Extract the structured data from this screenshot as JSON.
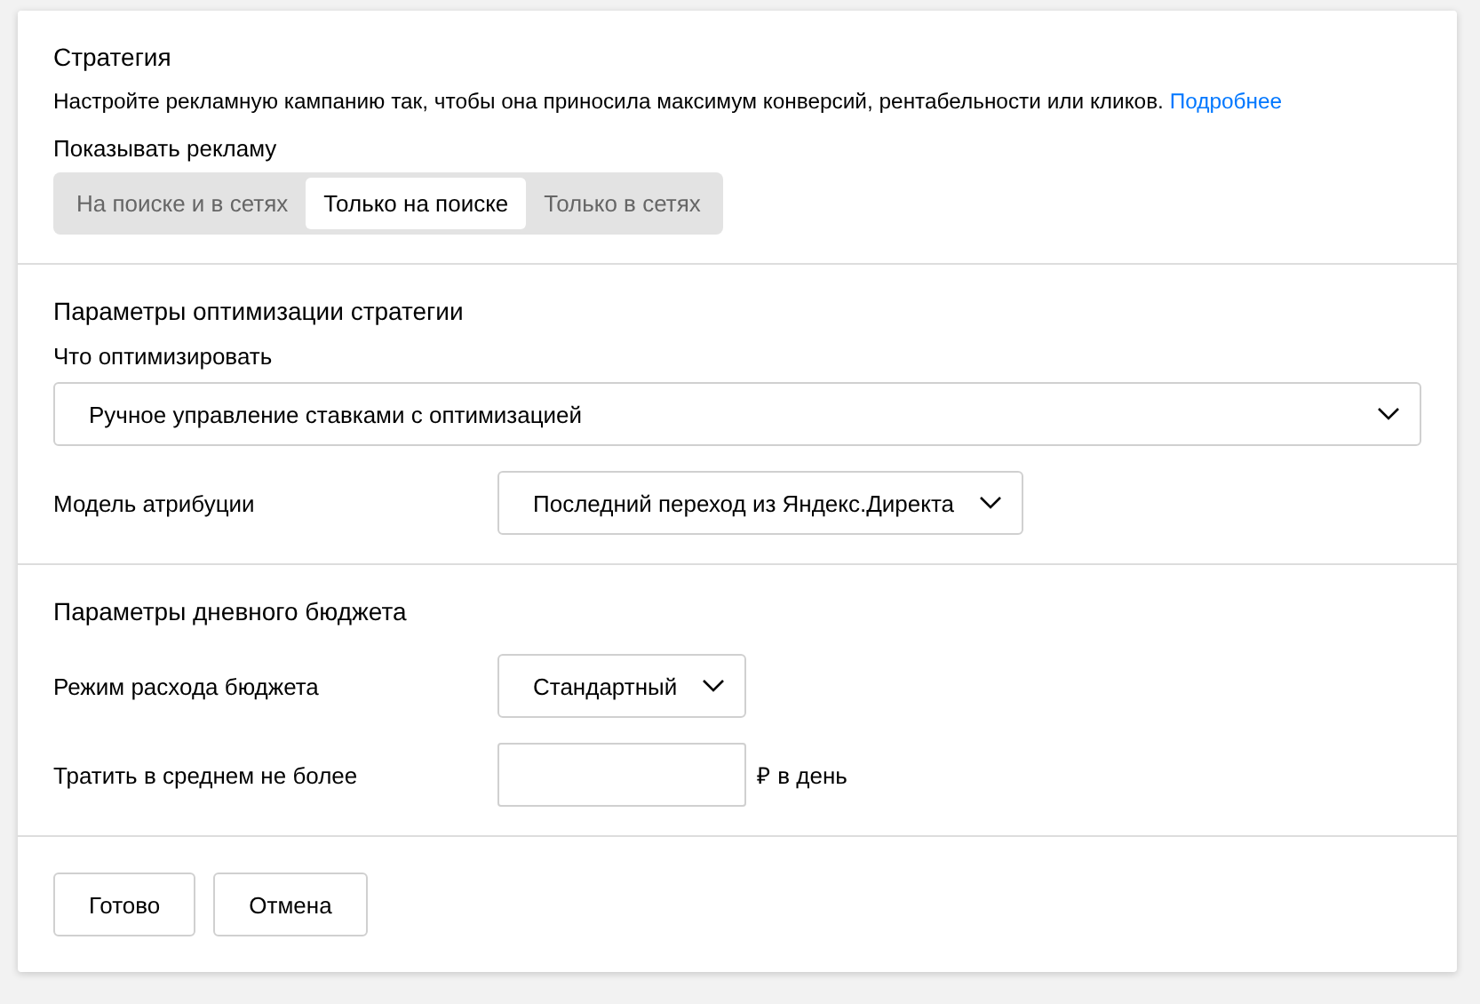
{
  "strategy": {
    "title": "Стратегия",
    "description": "Настройте рекламную кампанию так, чтобы она приносила максимум конверсий, рентабельности или кликов.",
    "link": "Подробнее",
    "show_label": "Показывать рекламу",
    "segments": [
      {
        "label": "На поиске и в сетях",
        "selected": false
      },
      {
        "label": "Только на поиске",
        "selected": true
      },
      {
        "label": "Только в сетях",
        "selected": false
      }
    ]
  },
  "optimization": {
    "title": "Параметры оптимизации стратегии",
    "goal_label": "Что оптимизировать",
    "goal_value": "Ручное управление ставками с оптимизацией",
    "attribution_label": "Модель атрибуции",
    "attribution_value": "Последний переход из Яндекс.Директа"
  },
  "budget": {
    "title": "Параметры дневного бюджета",
    "mode_label": "Режим расхода бюджета",
    "mode_value": "Стандартный",
    "limit_label": "Тратить в среднем не более",
    "limit_suffix": "₽ в день"
  },
  "buttons": [
    "Готово",
    "Отмена"
  ]
}
